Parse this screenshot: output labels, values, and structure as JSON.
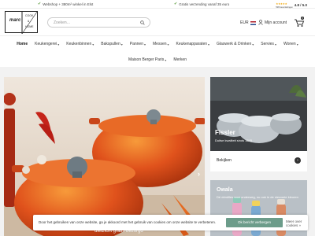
{
  "topbar": {
    "usp1": "Webshop + 380m² winkel in Elst",
    "usp2": "Gratis verzending vanaf 35 euro",
    "review_count": "538 beoordelingen",
    "score": "4.8 / 5.0",
    "stars": "★★★★★"
  },
  "logo": {
    "name": "marc",
    "cook": "COOK",
    "and": "&",
    "home": "HOME"
  },
  "search": {
    "placeholder": "Zoeken..."
  },
  "header": {
    "lang": "EUR",
    "account": "Mijn account",
    "cart_count": "0"
  },
  "nav": {
    "row1": [
      {
        "label": "Home",
        "caret": false
      },
      {
        "label": "Keukengerei",
        "caret": true
      },
      {
        "label": "Keukenbinnen",
        "caret": true
      },
      {
        "label": "Bakspullen",
        "caret": true
      },
      {
        "label": "Pannen",
        "caret": true
      },
      {
        "label": "Messen",
        "caret": true
      },
      {
        "label": "Keukenapparaten",
        "caret": true
      },
      {
        "label": "Glaswerk & Drinken",
        "caret": true
      },
      {
        "label": "Servies",
        "caret": true
      },
      {
        "label": "Wonen",
        "caret": true
      }
    ],
    "row2": [
      {
        "label": "Maison Berger Paris",
        "caret": true
      },
      {
        "label": "Merken",
        "caret": false
      }
    ]
  },
  "hero": {
    "caption": "dietzicht gratis bezorgd"
  },
  "side1": {
    "title": "Fissler",
    "subtitle": "Duitse kwaliteit sinds 1845",
    "link": "Bekijken"
  },
  "side2": {
    "title": "Owala",
    "subtitle": "Dé drinkfles voor onderweg, nu ook in de nieuwste kleuren"
  },
  "cookie": {
    "text": "Door het gebruiken van onze website, ga je akkoord met het gebruik van cookies om onze website te verbeteren.",
    "ok": "Ok bericht verbergen",
    "more": "Meer over cookies »"
  },
  "colors": {
    "accent": "#6c9c8a",
    "pot_orange": "#e0521c",
    "nav_text": "#333333"
  }
}
